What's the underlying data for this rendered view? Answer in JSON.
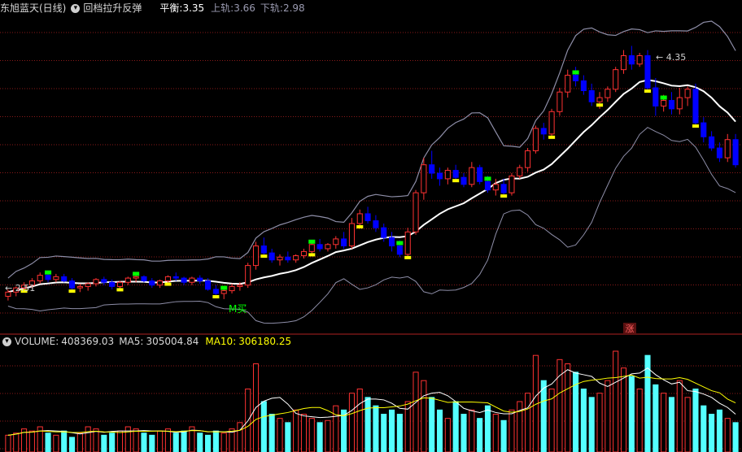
{
  "main_panel": {
    "stock_name": "东旭蓝天(日线)",
    "indicator_name": "回档拉升反弹",
    "balance_label": "平衡:",
    "balance_value": "3.35",
    "upper_label": "上轨:",
    "upper_value": "3.66",
    "lower_label": "下轨:",
    "lower_value": "2.98",
    "high_marker": "4.35",
    "low_marker": "2.51",
    "buy_signal": "M买",
    "rise_badge": "涨"
  },
  "volume_panel": {
    "volume_label": "VOLUME:",
    "volume_value": "408369.03",
    "ma5_label": "MA5:",
    "ma5_value": "305004.84",
    "ma10_label": "MA10:",
    "ma10_value": "306180.25"
  },
  "colors": {
    "up": "#ff3232",
    "down": "#0000ff",
    "mid": "#ffffff",
    "band": "#8e8ea8",
    "volume_down": "#54ffff",
    "ma5": "#ffffff",
    "ma10": "#ffff00",
    "signal_green": "#00ff00",
    "signal_yellow": "#ffff00",
    "grid": "#8a1a1a"
  },
  "chart_data": {
    "type": "candlestick",
    "ohlc": [
      [
        2.56,
        2.61,
        2.53,
        2.59
      ],
      [
        2.59,
        2.63,
        2.56,
        2.62
      ],
      [
        2.62,
        2.66,
        2.6,
        2.64
      ],
      [
        2.64,
        2.69,
        2.62,
        2.67
      ],
      [
        2.67,
        2.73,
        2.65,
        2.71
      ],
      [
        2.71,
        2.73,
        2.66,
        2.68
      ],
      [
        2.68,
        2.72,
        2.66,
        2.7
      ],
      [
        2.7,
        2.72,
        2.66,
        2.67
      ],
      [
        2.67,
        2.69,
        2.6,
        2.62
      ],
      [
        2.62,
        2.65,
        2.59,
        2.63
      ],
      [
        2.63,
        2.66,
        2.6,
        2.65
      ],
      [
        2.65,
        2.69,
        2.63,
        2.68
      ],
      [
        2.68,
        2.7,
        2.64,
        2.66
      ],
      [
        2.66,
        2.68,
        2.61,
        2.63
      ],
      [
        2.63,
        2.67,
        2.6,
        2.66
      ],
      [
        2.66,
        2.7,
        2.64,
        2.69
      ],
      [
        2.69,
        2.72,
        2.66,
        2.7
      ],
      [
        2.7,
        2.71,
        2.66,
        2.67
      ],
      [
        2.67,
        2.69,
        2.62,
        2.64
      ],
      [
        2.64,
        2.68,
        2.62,
        2.67
      ],
      [
        2.67,
        2.71,
        2.65,
        2.7
      ],
      [
        2.7,
        2.73,
        2.67,
        2.69
      ],
      [
        2.69,
        2.7,
        2.64,
        2.66
      ],
      [
        2.66,
        2.7,
        2.64,
        2.69
      ],
      [
        2.69,
        2.71,
        2.65,
        2.67
      ],
      [
        2.67,
        2.69,
        2.6,
        2.61
      ],
      [
        2.61,
        2.64,
        2.57,
        2.58
      ],
      [
        2.58,
        2.62,
        2.54,
        2.6
      ],
      [
        2.6,
        2.65,
        2.58,
        2.63
      ],
      [
        2.63,
        2.66,
        2.6,
        2.64
      ],
      [
        2.64,
        2.8,
        2.62,
        2.78
      ],
      [
        2.78,
        2.95,
        2.75,
        2.92
      ],
      [
        2.92,
        2.98,
        2.84,
        2.87
      ],
      [
        2.87,
        2.9,
        2.8,
        2.82
      ],
      [
        2.82,
        2.86,
        2.78,
        2.84
      ],
      [
        2.84,
        2.88,
        2.8,
        2.82
      ],
      [
        2.82,
        2.86,
        2.8,
        2.85
      ],
      [
        2.85,
        2.9,
        2.83,
        2.88
      ],
      [
        2.88,
        2.95,
        2.86,
        2.93
      ],
      [
        2.93,
        2.97,
        2.88,
        2.9
      ],
      [
        2.9,
        2.94,
        2.88,
        2.93
      ],
      [
        2.93,
        2.99,
        2.9,
        2.97
      ],
      [
        2.97,
        3.02,
        2.9,
        2.92
      ],
      [
        2.92,
        3.12,
        2.9,
        3.08
      ],
      [
        3.08,
        3.18,
        3.05,
        3.15
      ],
      [
        3.15,
        3.2,
        3.08,
        3.1
      ],
      [
        3.1,
        3.14,
        3.02,
        3.05
      ],
      [
        3.05,
        3.08,
        2.95,
        2.98
      ],
      [
        2.98,
        3.02,
        2.88,
        2.92
      ],
      [
        2.92,
        2.96,
        2.84,
        2.86
      ],
      [
        2.86,
        3.05,
        2.84,
        3.02
      ],
      [
        3.02,
        3.32,
        3.0,
        3.3
      ],
      [
        3.3,
        3.55,
        3.25,
        3.5
      ],
      [
        3.5,
        3.6,
        3.4,
        3.44
      ],
      [
        3.44,
        3.48,
        3.35,
        3.4
      ],
      [
        3.4,
        3.48,
        3.36,
        3.46
      ],
      [
        3.46,
        3.5,
        3.38,
        3.41
      ],
      [
        3.41,
        3.44,
        3.34,
        3.36
      ],
      [
        3.36,
        3.52,
        3.34,
        3.48
      ],
      [
        3.48,
        3.5,
        3.36,
        3.38
      ],
      [
        3.38,
        3.42,
        3.3,
        3.32
      ],
      [
        3.32,
        3.4,
        3.28,
        3.36
      ],
      [
        3.36,
        3.4,
        3.28,
        3.3
      ],
      [
        3.3,
        3.44,
        3.28,
        3.42
      ],
      [
        3.42,
        3.5,
        3.4,
        3.48
      ],
      [
        3.48,
        3.62,
        3.45,
        3.6
      ],
      [
        3.6,
        3.78,
        3.58,
        3.76
      ],
      [
        3.76,
        3.8,
        3.68,
        3.72
      ],
      [
        3.72,
        3.9,
        3.7,
        3.88
      ],
      [
        3.88,
        4.05,
        3.85,
        4.02
      ],
      [
        4.02,
        4.18,
        3.98,
        4.14
      ],
      [
        4.14,
        4.2,
        4.06,
        4.1
      ],
      [
        4.1,
        4.14,
        4.0,
        4.03
      ],
      [
        4.03,
        4.08,
        3.92,
        3.95
      ],
      [
        3.95,
        4.02,
        3.9,
        3.98
      ],
      [
        3.98,
        4.06,
        3.95,
        4.04
      ],
      [
        4.04,
        4.2,
        4.02,
        4.18
      ],
      [
        4.18,
        4.32,
        4.15,
        4.28
      ],
      [
        4.28,
        4.35,
        4.18,
        4.22
      ],
      [
        4.22,
        4.3,
        4.2,
        4.28
      ],
      [
        4.28,
        4.32,
        4.02,
        4.05
      ],
      [
        4.05,
        4.12,
        3.85,
        3.92
      ],
      [
        3.92,
        4.0,
        3.88,
        3.96
      ],
      [
        3.96,
        4.02,
        3.86,
        3.9
      ],
      [
        3.9,
        4.05,
        3.86,
        3.98
      ],
      [
        3.98,
        4.06,
        3.92,
        4.04
      ],
      [
        4.04,
        4.08,
        3.78,
        3.8
      ],
      [
        3.8,
        3.84,
        3.66,
        3.7
      ],
      [
        3.7,
        3.74,
        3.6,
        3.62
      ],
      [
        3.62,
        3.66,
        3.52,
        3.55
      ],
      [
        3.55,
        3.72,
        3.52,
        3.68
      ],
      [
        3.68,
        3.72,
        3.48,
        3.5
      ]
    ],
    "volume": [
      8,
      9,
      11,
      10,
      12,
      9,
      8,
      10,
      7,
      9,
      12,
      11,
      8,
      9,
      10,
      12,
      11,
      9,
      8,
      10,
      11,
      9,
      10,
      12,
      9,
      8,
      10,
      9,
      11,
      14,
      30,
      42,
      24,
      18,
      16,
      14,
      20,
      18,
      16,
      14,
      15,
      22,
      20,
      28,
      30,
      26,
      22,
      18,
      20,
      18,
      24,
      38,
      34,
      26,
      20,
      16,
      24,
      18,
      20,
      16,
      22,
      18,
      15,
      20,
      24,
      28,
      46,
      34,
      30,
      44,
      42,
      38,
      30,
      26,
      28,
      34,
      48,
      40,
      36,
      30,
      46,
      32,
      28,
      26,
      34,
      26,
      30,
      22,
      18,
      20,
      16,
      14
    ],
    "ylim": [
      2.4,
      4.55
    ]
  }
}
